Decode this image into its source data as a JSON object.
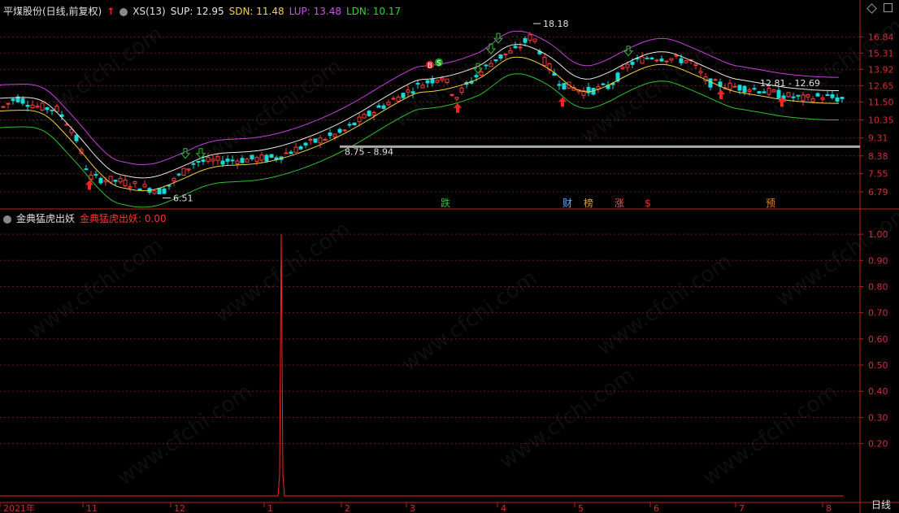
{
  "header": {
    "stock_name": "平煤股份(日线,前复权)",
    "indicator": "XS(13)",
    "sup": "SUP: 12.95",
    "sdn": "SDN: 11.48",
    "lup": "LUP: 13.48",
    "ldn": "LDN: 10.17",
    "arrow_up": "↑",
    "arrow_down": "↓"
  },
  "subheader": {
    "name": "金典猛虎出妖",
    "value_text": "金典猛虎出妖: 0.00"
  },
  "timeframe_label": "日线",
  "watermark": "www.cfchi.com",
  "colors": {
    "bg": "#000000",
    "axis": "#c81e1e",
    "grid": "#6a1a1a",
    "up": "#ff3b3b",
    "down": "#19d8d8",
    "white_line": "#e8e8e8",
    "yellow_line": "#f0d040",
    "purple_line": "#c840e0",
    "green_line": "#30c030",
    "signal": "#ff2020"
  },
  "chart_data": [
    {
      "type": "candlestick",
      "title": "平煤股份(日线,前复权)",
      "y_ticks": [
        16.84,
        15.31,
        13.92,
        12.65,
        11.5,
        10.35,
        9.31,
        8.38,
        7.55,
        6.79
      ],
      "y_scale": "log",
      "ylim": [
        6.2,
        19.0
      ],
      "x_ticks": [
        "2021年",
        "11",
        "12",
        "1",
        "2",
        "3",
        "4",
        "5",
        "6",
        "7",
        "8"
      ],
      "annotations": [
        {
          "label": "18.18",
          "type": "high"
        },
        {
          "label": "6.51",
          "type": "low"
        },
        {
          "label": "8.75 - 8.94",
          "type": "level"
        },
        {
          "label": "12.81 - 12.69",
          "type": "level"
        }
      ],
      "event_markers": [
        "跌",
        "财",
        "榜",
        "涨",
        "$",
        "预"
      ],
      "series_names": [
        "SUP",
        "SDN",
        "LUP",
        "LDN"
      ]
    },
    {
      "type": "line",
      "title": "金典猛虎出妖",
      "y_ticks": [
        1.0,
        0.9,
        0.8,
        0.7,
        0.6,
        0.5,
        0.4,
        0.3,
        0.2
      ],
      "ylim": [
        0,
        1.05
      ],
      "signal_peak": 1.0,
      "current_value": 0.0
    }
  ]
}
